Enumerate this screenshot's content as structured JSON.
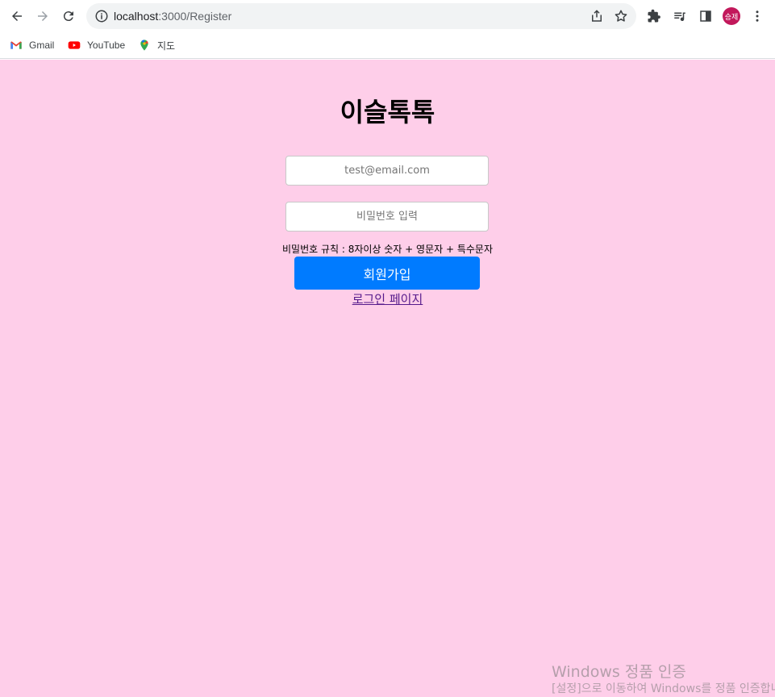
{
  "browser": {
    "url_host": "localhost",
    "url_path": ":3000/Register",
    "avatar_label": "승제",
    "bookmarks": [
      {
        "label": "Gmail",
        "icon": "gmail-icon"
      },
      {
        "label": "YouTube",
        "icon": "youtube-icon"
      },
      {
        "label": "지도",
        "icon": "maps-icon"
      }
    ]
  },
  "page": {
    "title": "이슬톡톡",
    "email_placeholder": "test@email.com",
    "password_placeholder": "비밀번호 입력",
    "password_rule": "비밀번호 규칙 : 8자이상 숫자 + 영문자 + 특수문자",
    "signup_label": "회원가입",
    "login_link": "로그인 페이지",
    "background_color": "#fecee9",
    "button_color": "#007bff"
  },
  "watermark": {
    "line1": "Windows 정품 인증",
    "line2": "[설정]으로 이동하여 Windows를 정품 인증합니다."
  }
}
